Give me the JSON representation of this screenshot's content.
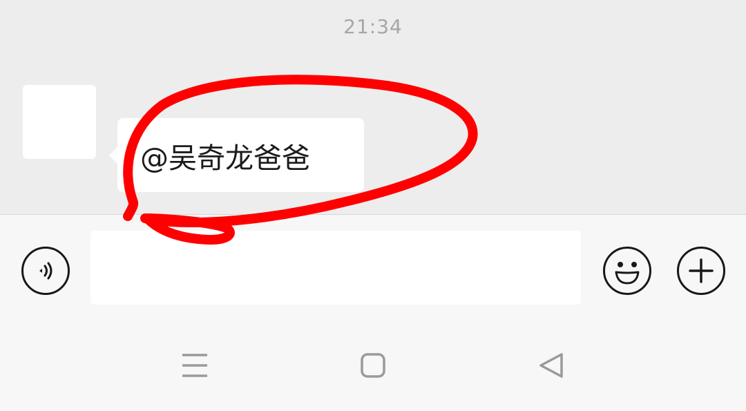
{
  "status": {
    "time": "21:34"
  },
  "chat": {
    "messages": [
      {
        "sender": "other",
        "text": "@吴奇龙爸爸"
      }
    ]
  },
  "annotation": {
    "type": "hand-drawn circle",
    "color": "#ff0000"
  },
  "input_bar": {
    "voice_icon": "voice-icon",
    "message_value": "",
    "emoji_icon": "emoji-icon",
    "plus_icon": "plus-icon"
  },
  "nav_bar": {
    "menu_icon": "menu-icon",
    "home_icon": "home-icon",
    "back_icon": "back-icon"
  },
  "colors": {
    "chat_background": "#ededed",
    "bubble": "#ffffff",
    "annotation": "#ff0000",
    "icon": "#181818",
    "nav_icon": "#9a9a9a"
  }
}
